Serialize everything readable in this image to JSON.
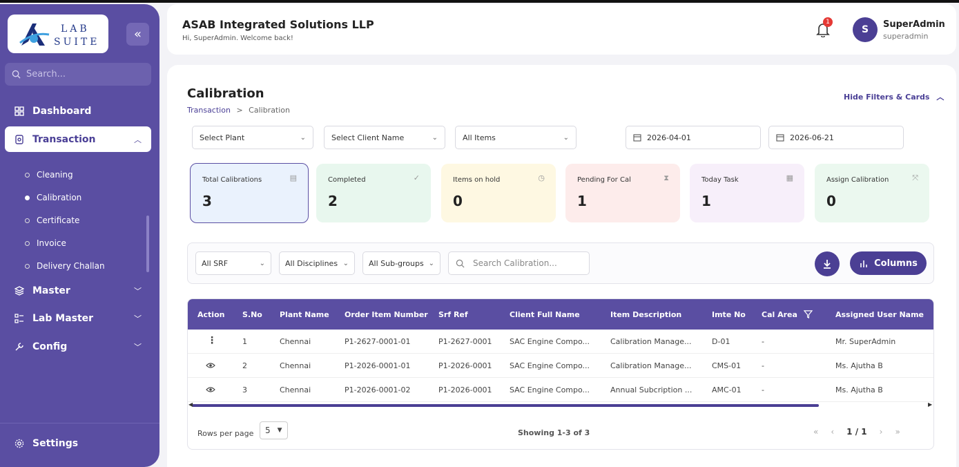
{
  "sidebar": {
    "logo": {
      "lab": "LAB",
      "suite": "SUITE"
    },
    "search_placeholder": "Search...",
    "nav": {
      "dashboard": "Dashboard",
      "transaction": "Transaction",
      "master": "Master",
      "lab_master": "Lab Master",
      "config": "Config",
      "settings": "Settings"
    },
    "transaction_sub": [
      "Cleaning",
      "Calibration",
      "Certificate",
      "Invoice",
      "Delivery Challan"
    ],
    "active_sub": "Calibration"
  },
  "header": {
    "company": "ASAB Integrated Solutions LLP",
    "welcome": "Hi, SuperAdmin. Welcome back!",
    "notification_count": "1",
    "avatar_initial": "S",
    "user_name": "SuperAdmin",
    "user_role": "superadmin"
  },
  "page": {
    "title": "Calibration",
    "breadcrumb": {
      "parent": "Transaction",
      "separator": ">",
      "current": "Calibration"
    },
    "hide_filters": "Hide Filters & Cards"
  },
  "filters": {
    "plant": "Select Plant",
    "client": "Select Client Name",
    "items": "All Items",
    "date_from": "2026-04-01",
    "date_to": "2026-06-21"
  },
  "cards": [
    {
      "label": "Total Calibrations",
      "value": "3",
      "icon": "document-icon"
    },
    {
      "label": "Completed",
      "value": "2",
      "icon": "check-circle-icon"
    },
    {
      "label": "Items on hold",
      "value": "0",
      "icon": "clock-icon"
    },
    {
      "label": "Pending For Cal",
      "value": "1",
      "icon": "hourglass-icon"
    },
    {
      "label": "Today Task",
      "value": "1",
      "icon": "calendar-icon"
    },
    {
      "label": "Assign Calibration",
      "value": "0",
      "icon": "assign-icon"
    }
  ],
  "toolbar": {
    "srf": "All SRF",
    "disciplines": "All Disciplines",
    "subgroups": "All Sub-groups",
    "search_placeholder": "Search Calibration...",
    "columns": "Columns"
  },
  "table": {
    "headers": [
      "Action",
      "S.No",
      "Plant Name",
      "Order Item Number",
      "Srf Ref",
      "Client Full Name",
      "Item Description",
      "Imte No",
      "Cal Area",
      "Assigned User Name"
    ],
    "rows": [
      {
        "action": "more",
        "sno": "1",
        "plant": "Chennai",
        "order": "P1-2627-0001-01",
        "srf": "P1-2627-0001",
        "client": "SAC Engine Compo...",
        "desc": "Calibration Manage...",
        "imte": "D-01",
        "area": "-",
        "user": "Mr. SuperAdmin"
      },
      {
        "action": "view",
        "sno": "2",
        "plant": "Chennai",
        "order": "P1-2026-0001-01",
        "srf": "P1-2026-0001",
        "client": "SAC Engine Compo...",
        "desc": "Calibration Manage...",
        "imte": "CMS-01",
        "area": "-",
        "user": "Ms. Ajutha B"
      },
      {
        "action": "view",
        "sno": "3",
        "plant": "Chennai",
        "order": "P1-2026-0001-02",
        "srf": "P1-2026-0001",
        "client": "SAC Engine Compo...",
        "desc": "Annual Subcription ...",
        "imte": "AMC-01",
        "area": "-",
        "user": "Ms. Ajutha B"
      }
    ],
    "rows_per_page_label": "Rows per page",
    "rows_per_page": "5",
    "showing": "Showing 1-3 of 3",
    "page": "1",
    "pages": "1"
  },
  "colors": {
    "primary": "#5a4ea2",
    "accent": "#4b3f94"
  }
}
